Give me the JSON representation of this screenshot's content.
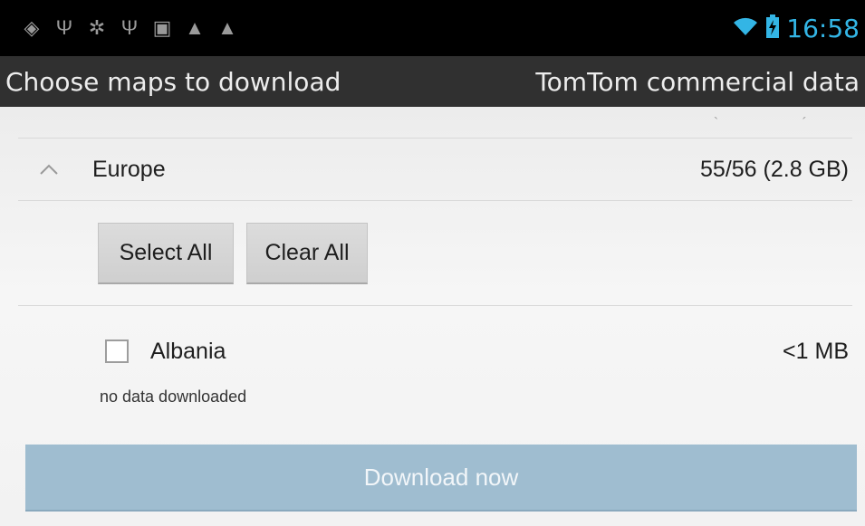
{
  "status_bar": {
    "time": "16:58",
    "left_icons": [
      "location-icon",
      "usb-icon",
      "android-debug-icon",
      "usb-icon",
      "image-icon",
      "warning-icon",
      "warning-icon"
    ],
    "right_icons": [
      "wifi-icon",
      "battery-charging-icon"
    ],
    "time_color": "#33b5e5"
  },
  "action_bar": {
    "title": "Choose maps to download",
    "subtitle": "TomTom commercial data"
  },
  "region": {
    "name": "Europe",
    "count": "55/56 (2.8 GB)",
    "icon": "chevron-up-icon"
  },
  "buttons": {
    "select_all": "Select All",
    "clear_all": "Clear All"
  },
  "items": [
    {
      "name": "Albania",
      "size": "<1 MB",
      "status": "no data downloaded",
      "checked": false
    }
  ],
  "download": {
    "label": "Download now",
    "color": "#9fbdd0"
  }
}
